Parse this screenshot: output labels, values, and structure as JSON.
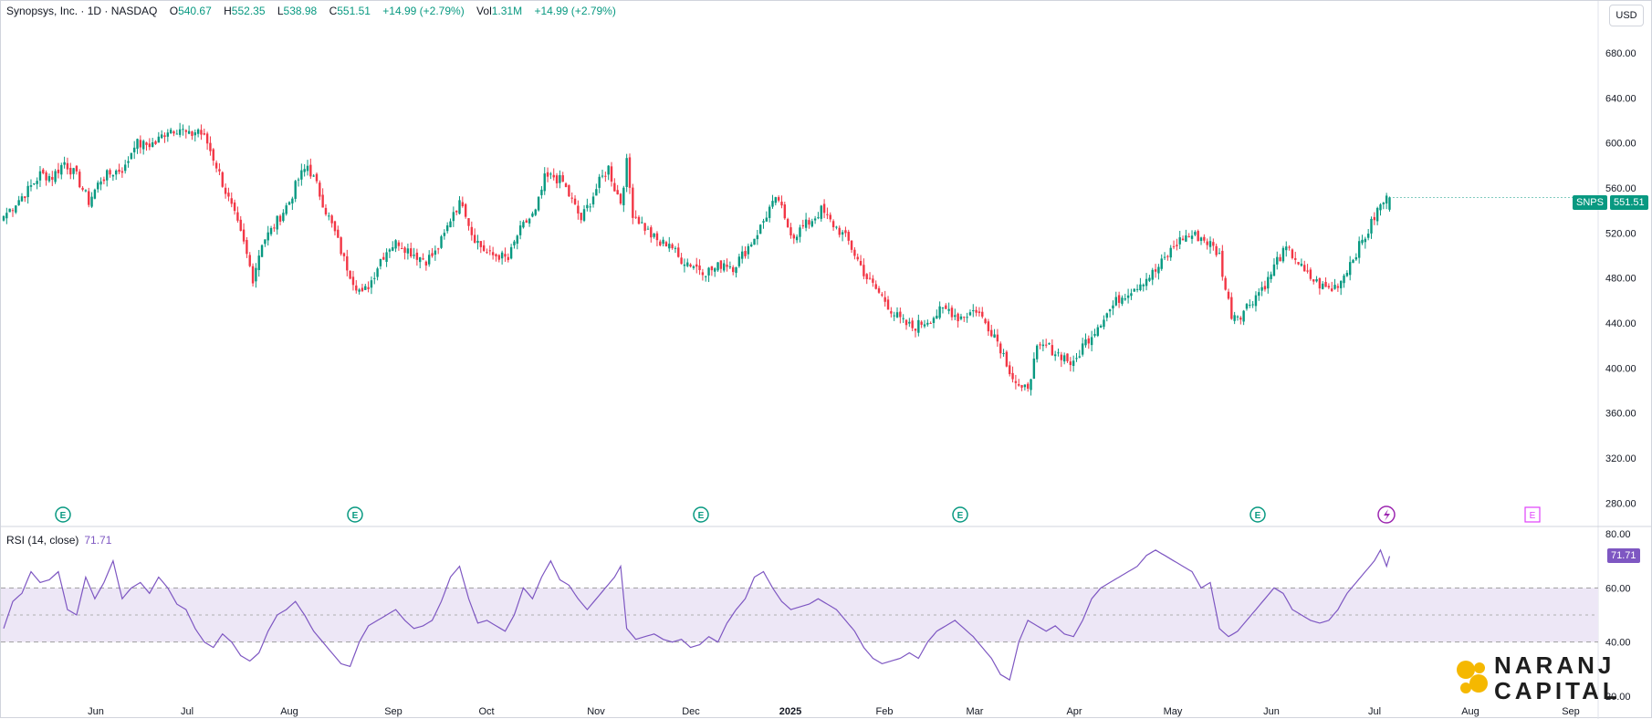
{
  "header": {
    "symbol": "Synopsys, Inc. · 1D · NASDAQ",
    "open_label": "O",
    "open": "540.67",
    "high_label": "H",
    "high": "552.35",
    "low_label": "L",
    "low": "538.98",
    "close_label": "C",
    "close": "551.51",
    "change": "+14.99 (+2.79%)",
    "vol_label": "Vol",
    "vol": "1.31M",
    "vol_change": "+14.99 (+2.79%)"
  },
  "currency": "USD",
  "price_tag": {
    "symbol": "SNPS",
    "value": "551.51"
  },
  "rsi": {
    "label": "RSI (14, close)",
    "value": "71.71",
    "tag": "71.71"
  },
  "logo": {
    "line1": "NARANJ",
    "line2": "CAPITAL"
  },
  "earnings_markers": [
    "E",
    "E",
    "E",
    "E",
    "E",
    "E"
  ],
  "colors": {
    "up": "#089981",
    "down": "#f23645",
    "rsi": "#7e57c2",
    "band": "#ede7f6",
    "logo_accent": "#f5b800",
    "future_marker": "#e040fb"
  },
  "chart_data": {
    "type": "candlestick",
    "price_axis": {
      "range": [
        260,
        710
      ],
      "ticks": [
        "680.00",
        "640.00",
        "600.00",
        "560.00",
        "520.00",
        "480.00",
        "440.00",
        "400.00",
        "360.00",
        "320.00",
        "280.00"
      ]
    },
    "rsi_axis": {
      "range": [
        20,
        80
      ],
      "ticks": [
        "80.00",
        "60.00",
        "40.00",
        "20.00"
      ],
      "bands": [
        40,
        60
      ]
    },
    "x_labels": [
      "Jun",
      "Jul",
      "Aug",
      "Sep",
      "Oct",
      "Nov",
      "Dec",
      "2025",
      "Feb",
      "Mar",
      "Apr",
      "May",
      "Jun",
      "Jul",
      "Aug",
      "Sep"
    ],
    "waypoints": [
      [
        0,
        535
      ],
      [
        4,
        547
      ],
      [
        8,
        558
      ],
      [
        12,
        572
      ],
      [
        16,
        570
      ],
      [
        20,
        583
      ],
      [
        24,
        570
      ],
      [
        28,
        548
      ],
      [
        32,
        568
      ],
      [
        36,
        574
      ],
      [
        40,
        578
      ],
      [
        43,
        600
      ],
      [
        46,
        598
      ],
      [
        50,
        600
      ],
      [
        54,
        612
      ],
      [
        58,
        613
      ],
      [
        61,
        606
      ],
      [
        64,
        612
      ],
      [
        67,
        600
      ],
      [
        70,
        580
      ],
      [
        73,
        557
      ],
      [
        76,
        535
      ],
      [
        79,
        510
      ],
      [
        82,
        480
      ],
      [
        85,
        512
      ],
      [
        88,
        522
      ],
      [
        91,
        535
      ],
      [
        94,
        548
      ],
      [
        97,
        568
      ],
      [
        100,
        580
      ],
      [
        103,
        562
      ],
      [
        106,
        540
      ],
      [
        109,
        520
      ],
      [
        112,
        496
      ],
      [
        115,
        478
      ],
      [
        118,
        465
      ],
      [
        121,
        478
      ],
      [
        124,
        497
      ],
      [
        127,
        508
      ],
      [
        130,
        512
      ],
      [
        133,
        505
      ],
      [
        136,
        500
      ],
      [
        139,
        496
      ],
      [
        142,
        502
      ],
      [
        145,
        518
      ],
      [
        148,
        540
      ],
      [
        151,
        548
      ],
      [
        154,
        520
      ],
      [
        157,
        508
      ],
      [
        160,
        500
      ],
      [
        163,
        500
      ],
      [
        166,
        496
      ],
      [
        169,
        518
      ],
      [
        172,
        530
      ],
      [
        175,
        538
      ],
      [
        178,
        568
      ],
      [
        181,
        570
      ],
      [
        184,
        565
      ],
      [
        187,
        548
      ],
      [
        190,
        532
      ],
      [
        193,
        548
      ],
      [
        196,
        565
      ],
      [
        199,
        578
      ],
      [
        201,
        560
      ],
      [
        203,
        548
      ],
      [
        205,
        582
      ],
      [
        207,
        538
      ],
      [
        210,
        528
      ],
      [
        213,
        518
      ],
      [
        216,
        510
      ],
      [
        219,
        512
      ],
      [
        222,
        498
      ],
      [
        225,
        494
      ],
      [
        228,
        490
      ],
      [
        231,
        486
      ],
      [
        234,
        488
      ],
      [
        237,
        494
      ],
      [
        240,
        490
      ],
      [
        243,
        500
      ],
      [
        246,
        512
      ],
      [
        249,
        525
      ],
      [
        252,
        542
      ],
      [
        255,
        550
      ],
      [
        257,
        530
      ],
      [
        260,
        518
      ],
      [
        263,
        525
      ],
      [
        266,
        532
      ],
      [
        269,
        540
      ],
      [
        272,
        530
      ],
      [
        275,
        522
      ],
      [
        278,
        512
      ],
      [
        281,
        496
      ],
      [
        284,
        480
      ],
      [
        287,
        470
      ],
      [
        290,
        460
      ],
      [
        293,
        448
      ],
      [
        296,
        440
      ],
      [
        299,
        436
      ],
      [
        302,
        440
      ],
      [
        305,
        444
      ],
      [
        308,
        450
      ],
      [
        311,
        452
      ],
      [
        314,
        445
      ],
      [
        317,
        448
      ],
      [
        320,
        452
      ],
      [
        323,
        440
      ],
      [
        326,
        430
      ],
      [
        329,
        412
      ],
      [
        332,
        392
      ],
      [
        335,
        378
      ],
      [
        337,
        385
      ],
      [
        340,
        415
      ],
      [
        343,
        420
      ],
      [
        346,
        414
      ],
      [
        349,
        410
      ],
      [
        352,
        402
      ],
      [
        355,
        420
      ],
      [
        358,
        430
      ],
      [
        361,
        442
      ],
      [
        364,
        452
      ],
      [
        367,
        462
      ],
      [
        370,
        468
      ],
      [
        373,
        474
      ],
      [
        376,
        480
      ],
      [
        379,
        486
      ],
      [
        382,
        497
      ],
      [
        385,
        508
      ],
      [
        388,
        516
      ],
      [
        391,
        518
      ],
      [
        394,
        516
      ],
      [
        397,
        510
      ],
      [
        400,
        500
      ],
      [
        402,
        470
      ],
      [
        404,
        448
      ],
      [
        407,
        448
      ],
      [
        410,
        458
      ],
      [
        413,
        468
      ],
      [
        416,
        478
      ],
      [
        419,
        496
      ],
      [
        422,
        505
      ],
      [
        425,
        498
      ],
      [
        428,
        484
      ],
      [
        431,
        478
      ],
      [
        434,
        472
      ],
      [
        437,
        470
      ],
      [
        440,
        478
      ],
      [
        443,
        494
      ],
      [
        446,
        508
      ],
      [
        449,
        522
      ],
      [
        452,
        540
      ],
      [
        454,
        548
      ],
      [
        456,
        551.5
      ]
    ],
    "rsi_waypoints": [
      [
        0,
        45
      ],
      [
        3,
        55
      ],
      [
        6,
        58
      ],
      [
        9,
        66
      ],
      [
        12,
        62
      ],
      [
        15,
        63
      ],
      [
        18,
        66
      ],
      [
        21,
        52
      ],
      [
        24,
        50
      ],
      [
        27,
        64
      ],
      [
        30,
        56
      ],
      [
        33,
        62
      ],
      [
        36,
        70
      ],
      [
        39,
        56
      ],
      [
        42,
        60
      ],
      [
        45,
        62
      ],
      [
        48,
        58
      ],
      [
        51,
        64
      ],
      [
        54,
        60
      ],
      [
        57,
        54
      ],
      [
        60,
        52
      ],
      [
        63,
        45
      ],
      [
        66,
        40
      ],
      [
        69,
        38
      ],
      [
        72,
        43
      ],
      [
        75,
        40
      ],
      [
        78,
        35
      ],
      [
        81,
        33
      ],
      [
        84,
        36
      ],
      [
        87,
        44
      ],
      [
        90,
        50
      ],
      [
        93,
        52
      ],
      [
        96,
        55
      ],
      [
        99,
        50
      ],
      [
        102,
        44
      ],
      [
        105,
        40
      ],
      [
        108,
        36
      ],
      [
        111,
        32
      ],
      [
        114,
        31
      ],
      [
        117,
        40
      ],
      [
        120,
        46
      ],
      [
        123,
        48
      ],
      [
        126,
        50
      ],
      [
        129,
        52
      ],
      [
        132,
        48
      ],
      [
        135,
        45
      ],
      [
        138,
        46
      ],
      [
        141,
        48
      ],
      [
        144,
        55
      ],
      [
        147,
        64
      ],
      [
        150,
        68
      ],
      [
        153,
        56
      ],
      [
        156,
        47
      ],
      [
        159,
        48
      ],
      [
        162,
        46
      ],
      [
        165,
        44
      ],
      [
        168,
        50
      ],
      [
        171,
        60
      ],
      [
        174,
        56
      ],
      [
        177,
        64
      ],
      [
        180,
        70
      ],
      [
        183,
        63
      ],
      [
        186,
        61
      ],
      [
        189,
        56
      ],
      [
        192,
        52
      ],
      [
        195,
        56
      ],
      [
        198,
        60
      ],
      [
        201,
        64
      ],
      [
        203,
        68
      ],
      [
        205,
        45
      ],
      [
        208,
        41
      ],
      [
        211,
        42
      ],
      [
        214,
        43
      ],
      [
        217,
        41
      ],
      [
        220,
        40
      ],
      [
        223,
        41
      ],
      [
        226,
        38
      ],
      [
        229,
        39
      ],
      [
        232,
        42
      ],
      [
        235,
        40
      ],
      [
        238,
        47
      ],
      [
        241,
        52
      ],
      [
        244,
        56
      ],
      [
        247,
        64
      ],
      [
        250,
        66
      ],
      [
        253,
        60
      ],
      [
        256,
        55
      ],
      [
        259,
        52
      ],
      [
        262,
        53
      ],
      [
        265,
        54
      ],
      [
        268,
        56
      ],
      [
        271,
        54
      ],
      [
        274,
        52
      ],
      [
        277,
        48
      ],
      [
        280,
        44
      ],
      [
        283,
        38
      ],
      [
        286,
        34
      ],
      [
        289,
        32
      ],
      [
        292,
        33
      ],
      [
        295,
        34
      ],
      [
        298,
        36
      ],
      [
        301,
        34
      ],
      [
        304,
        40
      ],
      [
        307,
        44
      ],
      [
        310,
        46
      ],
      [
        313,
        48
      ],
      [
        316,
        45
      ],
      [
        319,
        42
      ],
      [
        322,
        38
      ],
      [
        325,
        34
      ],
      [
        328,
        28
      ],
      [
        331,
        26
      ],
      [
        334,
        40
      ],
      [
        337,
        48
      ],
      [
        340,
        46
      ],
      [
        343,
        44
      ],
      [
        346,
        46
      ],
      [
        349,
        43
      ],
      [
        352,
        42
      ],
      [
        355,
        48
      ],
      [
        358,
        56
      ],
      [
        361,
        60
      ],
      [
        364,
        62
      ],
      [
        367,
        64
      ],
      [
        370,
        66
      ],
      [
        373,
        68
      ],
      [
        376,
        72
      ],
      [
        379,
        74
      ],
      [
        382,
        72
      ],
      [
        385,
        70
      ],
      [
        388,
        68
      ],
      [
        391,
        66
      ],
      [
        394,
        60
      ],
      [
        397,
        62
      ],
      [
        400,
        45
      ],
      [
        403,
        42
      ],
      [
        406,
        44
      ],
      [
        409,
        48
      ],
      [
        412,
        52
      ],
      [
        415,
        56
      ],
      [
        418,
        60
      ],
      [
        421,
        58
      ],
      [
        424,
        52
      ],
      [
        427,
        50
      ],
      [
        430,
        48
      ],
      [
        433,
        47
      ],
      [
        436,
        48
      ],
      [
        439,
        52
      ],
      [
        442,
        58
      ],
      [
        445,
        62
      ],
      [
        448,
        66
      ],
      [
        451,
        70
      ],
      [
        453,
        74
      ],
      [
        455,
        68
      ],
      [
        456,
        71.71
      ]
    ]
  }
}
